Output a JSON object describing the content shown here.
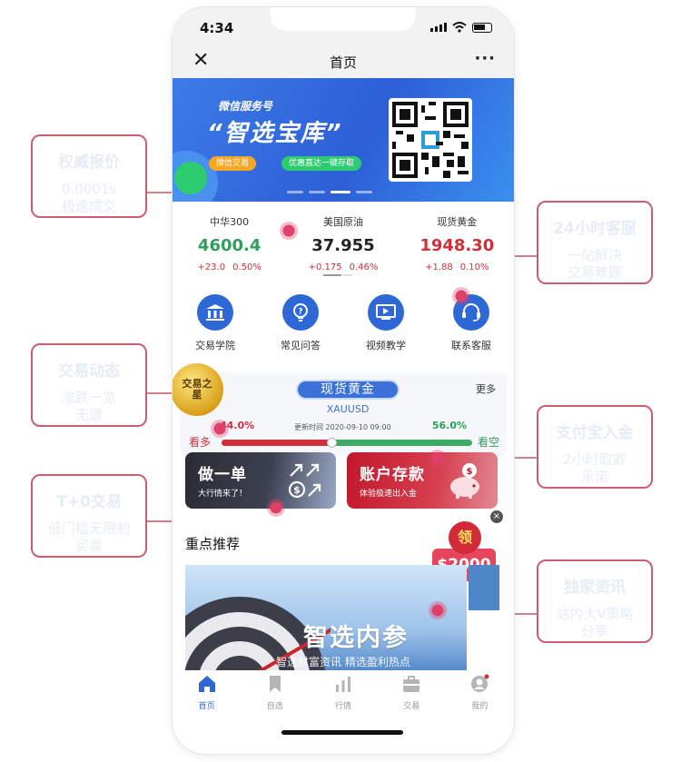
{
  "status_bar": {
    "time": "4:34"
  },
  "nav": {
    "close": "✕",
    "title": "首页",
    "more": "···"
  },
  "banner": {
    "subtitle": "微信服务号",
    "title": "“智选宝库”",
    "tag_left": "微信交易",
    "tag_right": "优惠直达一键存取"
  },
  "quotes": [
    {
      "name": "中华300",
      "price": "4600.4",
      "change": "+23.0",
      "pct": "0.50%",
      "trend": "down"
    },
    {
      "name": "美国原油",
      "price": "37.955",
      "change": "+0.175",
      "pct": "0.46%",
      "trend": "neutral"
    },
    {
      "name": "现货黄金",
      "price": "1948.30",
      "change": "+1.88",
      "pct": "0.10%",
      "trend": "up"
    }
  ],
  "menu": [
    {
      "label": "交易学院",
      "icon": "bank-icon"
    },
    {
      "label": "常见问答",
      "icon": "lightbulb-icon"
    },
    {
      "label": "视频教学",
      "icon": "video-teaching-icon"
    },
    {
      "label": "联系客服",
      "icon": "headset-icon"
    }
  ],
  "sentiment": {
    "medal": "交易之星",
    "product": "现货黄金",
    "symbol": "XAUUSD",
    "more": "更多",
    "bull_pct": "44.0%",
    "bear_pct": "56.0%",
    "bull_value": 0.44,
    "update": "更新时间 2020-09-10 09:00",
    "bull_label": "看多",
    "bear_label": "看空"
  },
  "promos": {
    "trade_title": "做一单",
    "trade_sub": "大行情来了！",
    "deposit_title": "账户存款",
    "deposit_sub": "体验极速出入金",
    "close": "×"
  },
  "recommend": {
    "title": "重点推荐",
    "packet_top": "领",
    "packet_amount": "$2000",
    "banner_title": "智选内参",
    "banner_sub": "智选财富资讯 精选盈利热点"
  },
  "tabs": [
    {
      "label": "首页",
      "active": true
    },
    {
      "label": "自选",
      "active": false
    },
    {
      "label": "行情",
      "active": false
    },
    {
      "label": "交易",
      "active": false
    },
    {
      "label": "我的",
      "active": false
    }
  ],
  "callouts": {
    "authority": {
      "title": "权威报价",
      "desc1": "0.0001s",
      "desc2": "极速成交"
    },
    "service": {
      "title": "24小时客服",
      "desc1": "一站解决",
      "desc2": "交易难题"
    },
    "dynamic": {
      "title": "交易动态",
      "desc1": "涨跌一览",
      "desc2": "无遗"
    },
    "alipay": {
      "title": "支付宝入金",
      "desc1": "2小时取款",
      "desc2": "承诺"
    },
    "t0": {
      "title": "T+0交易",
      "desc1": "低门槛无限制",
      "desc2": "买卖"
    },
    "exclusive": {
      "title": "独家资讯",
      "desc1": "站内大V策略",
      "desc2": "分享"
    }
  },
  "colors": {
    "accent": "#2d68d6",
    "rise": "#d0303a",
    "fall": "#2e9e5b",
    "callout_border": "#cf5d72"
  }
}
